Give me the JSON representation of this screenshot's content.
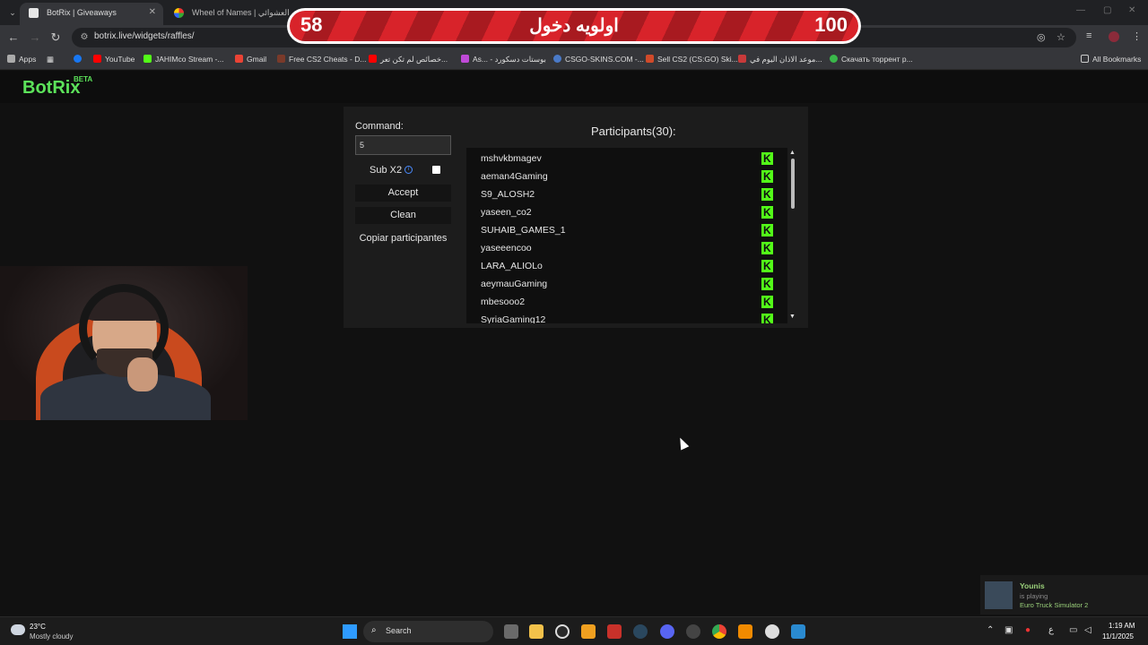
{
  "browser": {
    "tabs": [
      {
        "title": "BotRix | Giveaways",
        "active": true
      },
      {
        "title": "Wheel of Names | عسم العشوائي",
        "active": false
      }
    ],
    "url": "botrix.live/widgets/raffles/",
    "bookmarks": [
      "Apps",
      "YouTube",
      "JAHIMco Stream -...",
      "Gmail",
      "Free CS2 Cheats - D...",
      "خصائص لم تكن تعر...",
      "As... - بوستات دسكورد",
      "CSGO-SKINS.COM -...",
      "Sell CS2 (CS:GO) Ski...",
      "موعد الاذان اليوم في...",
      "Скачать торрент р..."
    ],
    "all_bookmarks": "All Bookmarks"
  },
  "overlay": {
    "left_number": "58",
    "center_text": "اولويه دخول",
    "right_number": "100"
  },
  "app": {
    "logo": "BotRix",
    "badge": "BETA"
  },
  "raffle": {
    "command_label": "Command:",
    "command_value": "5",
    "sub_label": "Sub X2",
    "accept_label": "Accept",
    "clean_label": "Clean",
    "copy_label": "Copiar participantes",
    "participants_title": "Participants(30):",
    "participants": [
      "mshvkbmagev",
      "aeman4Gaming",
      "S9_ALOSH2",
      "yaseen_co2",
      "SUHAIB_GAMES_1",
      "yaseeencoo",
      "LARA_ALIOLo",
      "aeymauGaming",
      "mbesooo2",
      "SyriaGaming12"
    ]
  },
  "notification": {
    "name": "Younis",
    "status": "is playing",
    "game": "Euro Truck Simulator 2"
  },
  "taskbar": {
    "temperature": "23°C",
    "condition": "Mostly cloudy",
    "search": "Search",
    "time": "1:19 AM",
    "date": "11/1/2025",
    "lang": "ع"
  }
}
